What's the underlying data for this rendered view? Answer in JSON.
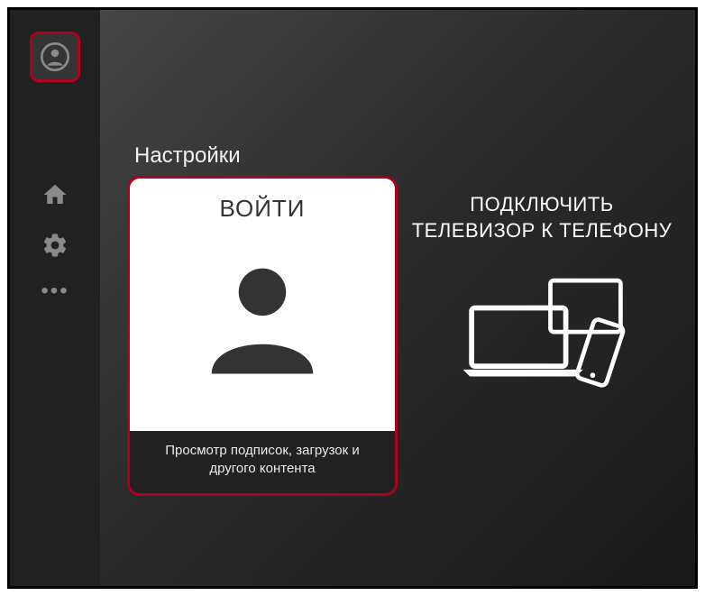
{
  "sidebar": {
    "account_icon": "account-icon",
    "home_icon": "home-icon",
    "settings_icon": "settings-icon",
    "more_icon": "more-icon"
  },
  "section": {
    "title": "Настройки"
  },
  "login_card": {
    "title": "ВОЙТИ",
    "subtitle": "Просмотр подписок, загрузок и другого контента"
  },
  "connect_card": {
    "title": "ПОДКЛЮЧИТЬ\nТЕЛЕВИЗОР К ТЕЛЕФОНУ"
  },
  "colors": {
    "highlight_border": "#b00020",
    "sidebar_bg": "#212121"
  }
}
